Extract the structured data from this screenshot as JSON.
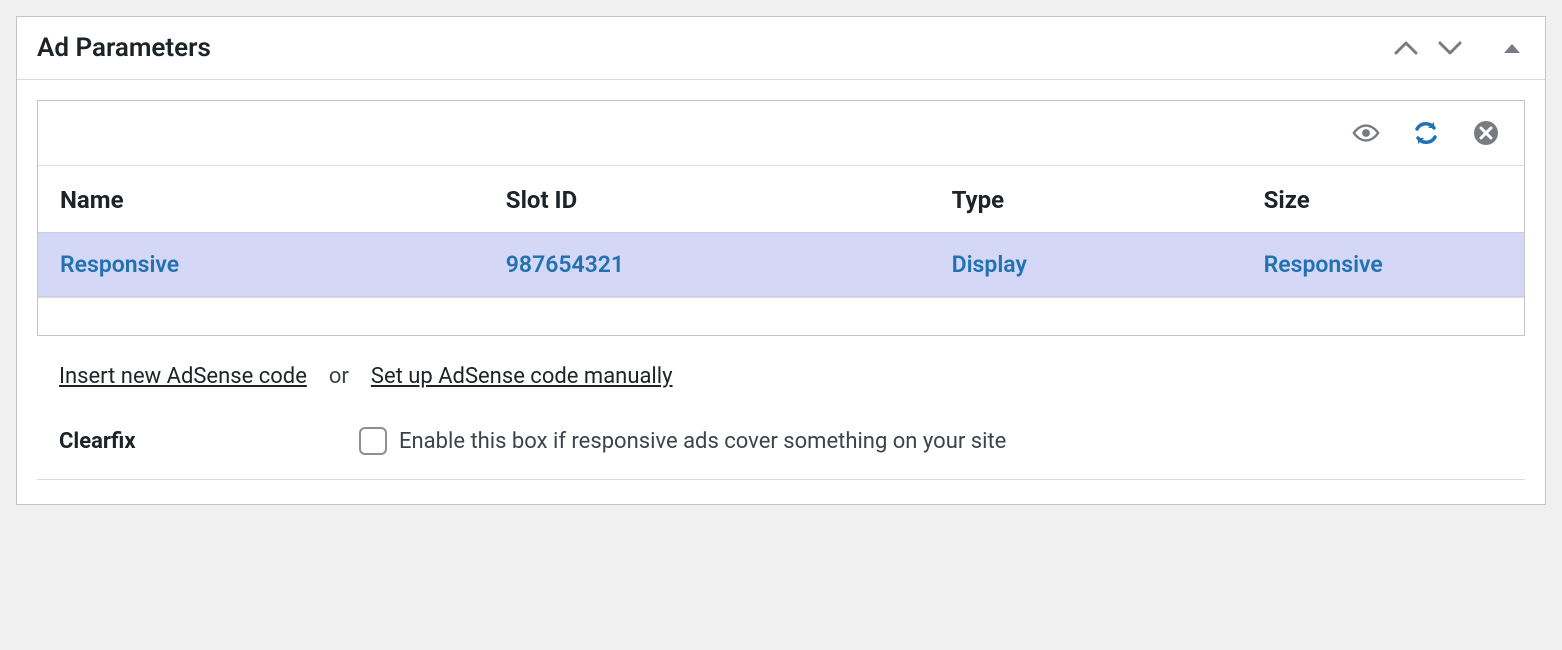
{
  "panel": {
    "title": "Ad Parameters"
  },
  "table": {
    "headers": {
      "name": "Name",
      "slot_id": "Slot ID",
      "type": "Type",
      "size": "Size"
    },
    "row": {
      "name": "Responsive",
      "slot_id": "987654321",
      "type": "Display",
      "size": "Responsive"
    }
  },
  "links": {
    "insert_new": "Insert new AdSense code",
    "or": "or",
    "manual": "Set up AdSense code manually"
  },
  "clearfix": {
    "label": "Clearfix",
    "text": "Enable this box if responsive ads cover something on your site"
  }
}
